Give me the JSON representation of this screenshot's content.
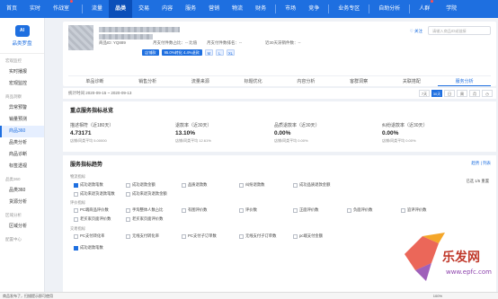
{
  "nav": [
    {
      "label": "首页"
    },
    {
      "label": "实时"
    },
    {
      "label": "作战室"
    },
    {
      "label": "流量"
    },
    {
      "label": "品类",
      "active": true
    },
    {
      "label": "交易"
    },
    {
      "label": "内容"
    },
    {
      "label": "服务"
    },
    {
      "label": "营销"
    },
    {
      "label": "物流"
    },
    {
      "label": "财务"
    },
    {
      "label": "市场"
    },
    {
      "label": "竞争"
    },
    {
      "label": "业务专区"
    },
    {
      "label": "自助分析"
    },
    {
      "label": "人群"
    },
    {
      "label": "学院"
    }
  ],
  "sidebar": {
    "logo_badge": "AI",
    "title": "品类罗盘",
    "groups": [
      {
        "label": "宏观监控",
        "items": [
          "实时播报",
          "宏观监控"
        ]
      },
      {
        "label": "商品洞察",
        "items": [
          "异常预警",
          "销量预测",
          "商品360",
          "品类分析",
          "商品诊断",
          "标签透视"
        ]
      },
      {
        "label": "品类360",
        "items": [
          "品类360",
          "货源分析"
        ]
      },
      {
        "label": "区域分析",
        "items": [
          "区域分析"
        ]
      },
      {
        "label": "配置中心",
        "items": []
      }
    ],
    "active": "商品360"
  },
  "shop": {
    "id_text": "商品ID: YQ889",
    "meta1": "月支付件数占比：-- 比值",
    "meta2": "月支付件数排名：--",
    "meta3": "近30天滞销件数：--",
    "tag_main": "店铺款",
    "tag_rate": "95.0%转化 4.4%退款",
    "tags_small": [
      "M",
      "L",
      "XL"
    ],
    "follow": "♡ 关注",
    "search_placeholder": "请输入商品ID或链接",
    "tabs": [
      "单品诊断",
      "销售分析",
      "流量来源",
      "标题优化",
      "内容分析",
      "客群洞察",
      "关联搭配",
      "服务分析"
    ],
    "active_tab": "服务分析"
  },
  "date": {
    "label": "统计时间 2020-09-15 ~ 2020-09-13",
    "ranges": [
      "7天",
      "30天",
      "日",
      "周",
      "月",
      "◷"
    ],
    "active_range": "30天"
  },
  "overview": {
    "title": "重点服务指标总览",
    "metrics": [
      {
        "label": "描述相符（近180天）",
        "value": "4.73171",
        "sub": "店铺/同类平均 5.00000"
      },
      {
        "label": "退款率（近30天）",
        "value": "13.10%",
        "sub": "店铺/同类平均 12.61%"
      },
      {
        "label": "品质退款率（近30天）",
        "value": "0.00%",
        "sub": "店铺/同类平均 0.00%"
      },
      {
        "label": "纠纷退款率（近30天）",
        "value": "0.00%",
        "sub": "店铺/同类平均 0.00%"
      }
    ]
  },
  "trend": {
    "title": "服务指标趋势",
    "actions": "趋势 | 列表",
    "selected_text": "已选 1/5 重置",
    "groups": [
      {
        "label": "物流指标",
        "items": [
          "成功退款笔数",
          "成功退款金额",
          "品质退款数",
          "纠纷退款数",
          "成功品质退款金额",
          "成功来退货退款笔数",
          "成功来退货退款金额"
        ]
      },
      {
        "label": "评价指标",
        "items": [
          "PC端商品评价数",
          "手淘整体人数占比",
          "有图评价数",
          "评价数",
          "正面评价数",
          "负面评价数",
          "追评评价数",
          "老买家页面评价数",
          "老买家页面评价数"
        ]
      },
      {
        "label": "交易指标",
        "items": [
          "PC支付转化率",
          "无线支付转化率",
          "PC支付子订单数",
          "无线支付子订单数",
          "pc端支付金额"
        ]
      },
      {
        "label": "",
        "items": [
          "成功退款笔数"
        ]
      }
    ]
  },
  "status": {
    "left": "商品发布了，扫描提示即可使用",
    "right": "100%"
  },
  "watermark": {
    "brand": "乐发网",
    "url": "www.epfc.com"
  },
  "colors": {
    "primary": "#1e6fe0",
    "nav_active": "#0b4fb9"
  }
}
